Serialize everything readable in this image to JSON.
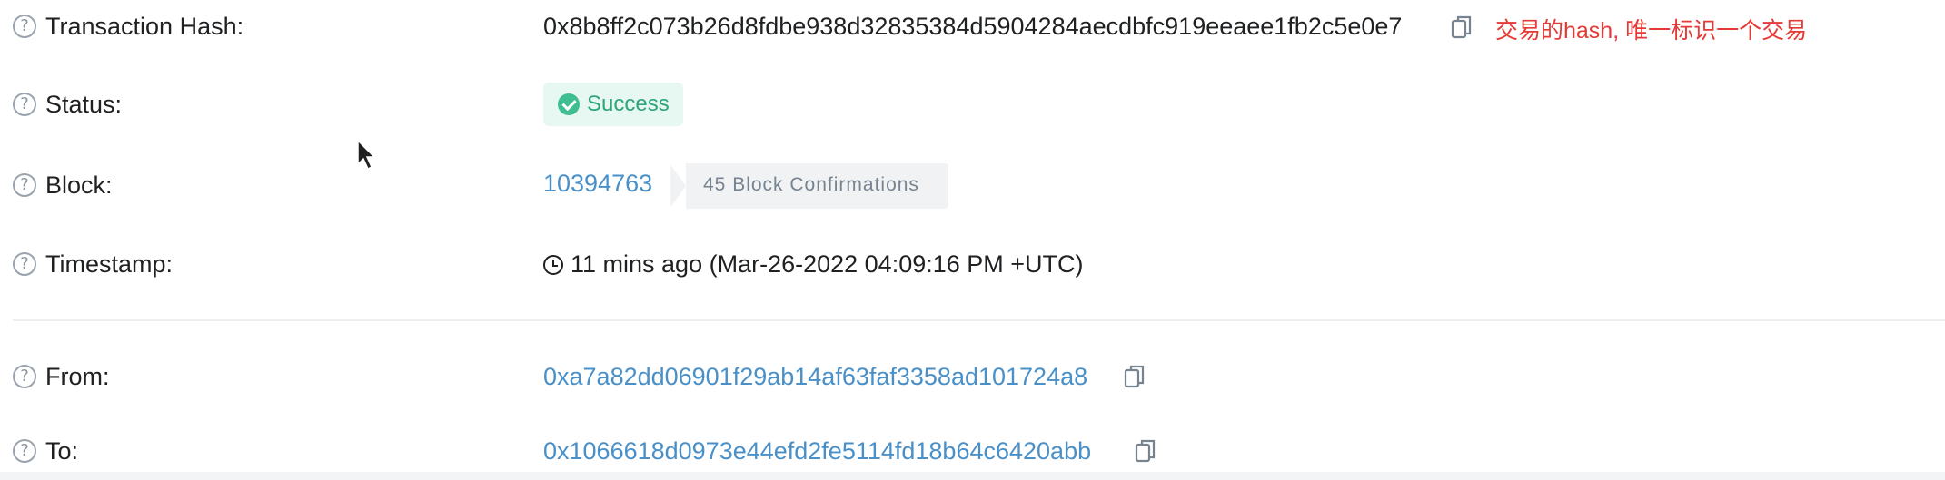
{
  "help_glyph": "?",
  "rows": {
    "tx_hash": {
      "label": "Transaction Hash:",
      "value": "0x8b8ff2c073b26d8fdbe938d32835384d5904284aecdbfc919eeaee1fb2c5e0e7",
      "annotation": "交易的hash, 唯一标识一个交易",
      "icon": "copy-icon"
    },
    "status": {
      "label": "Status:",
      "value": "Success",
      "icon": "check-circle-icon",
      "color": "#3fbf91"
    },
    "block": {
      "label": "Block:",
      "value": "10394763",
      "confirmations": "45 Block Confirmations"
    },
    "timestamp": {
      "label": "Timestamp:",
      "value": "11 mins ago (Mar-26-2022 04:09:16 PM +UTC)",
      "icon": "clock-icon"
    },
    "from": {
      "label": "From:",
      "value": "0xa7a82dd06901f29ab14af63faf3358ad101724a8",
      "icon": "copy-icon"
    },
    "to": {
      "label": "To:",
      "value": "0x1066618d0973e44efd2fe5114fd18b64c6420abb",
      "icon": "copy-icon"
    }
  },
  "colors": {
    "link": "#4a90c8",
    "annotation": "#e53935",
    "success": "#3fbf91"
  }
}
